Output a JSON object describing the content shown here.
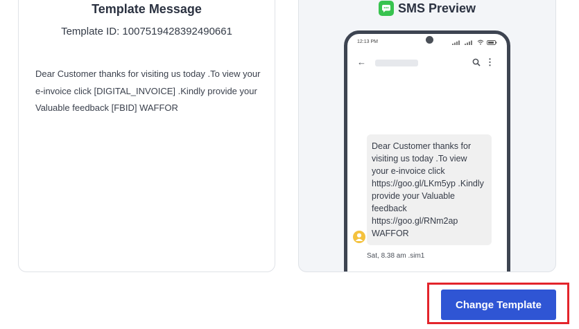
{
  "template_card": {
    "title": "Template Message",
    "template_id": "Template ID: 1007519428392490661",
    "body": "Dear Customer thanks for visiting us today .To view your e-invoice click [DIGITAL_INVOICE] .Kindly provide your Valuable feedback [FBID] WAFFOR"
  },
  "preview_card": {
    "title": "SMS Preview",
    "icon": "message-bubble-icon",
    "phone": {
      "time": "12:13 PM",
      "message": "Dear Customer thanks for visiting us today .To view your e-invoice click https://goo.gl/LKm5yp .Kindly provide your Valuable feedback https://goo.gl/RNm2ap WAFFOR",
      "timestamp": "Sat, 8.38 am .sim1"
    }
  },
  "actions": {
    "change_template_label": "Change Template"
  },
  "colors": {
    "primary_button": "#2f55d4",
    "highlight_border": "#e3242b",
    "sms_icon": "#38c34f"
  }
}
